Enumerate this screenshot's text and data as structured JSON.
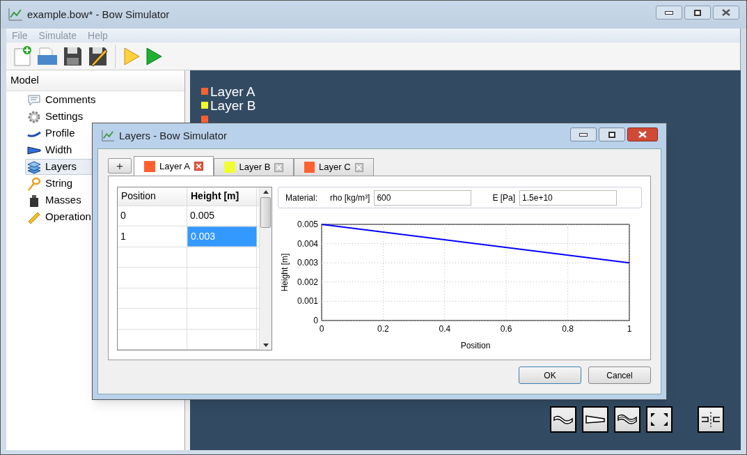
{
  "window": {
    "title": "example.bow* - Bow Simulator"
  },
  "menu": [
    "File",
    "Simulate",
    "Help"
  ],
  "sidebar": {
    "header": "Model",
    "items": [
      {
        "label": "Comments",
        "selected": false
      },
      {
        "label": "Settings",
        "selected": false
      },
      {
        "label": "Profile",
        "selected": false
      },
      {
        "label": "Width",
        "selected": false
      },
      {
        "label": "Layers",
        "selected": true
      },
      {
        "label": "String",
        "selected": false
      },
      {
        "label": "Masses",
        "selected": false
      },
      {
        "label": "Operation",
        "selected": false
      }
    ]
  },
  "legend": [
    {
      "label": "Layer A",
      "color": "#ff6030"
    },
    {
      "label": "Layer B",
      "color": "#f0ff30"
    },
    {
      "color": "#ff6030"
    }
  ],
  "dialog": {
    "title": "Layers - Bow Simulator",
    "add_button": "+",
    "tabs": [
      {
        "label": "Layer A",
        "color": "#ff6030",
        "selected": true
      },
      {
        "label": "Layer B",
        "color": "#f0ff30",
        "selected": false
      },
      {
        "label": "Layer C",
        "color": "#ff6030",
        "selected": false
      }
    ],
    "table": {
      "columns": [
        "Position",
        "Height [m]"
      ],
      "rows": [
        {
          "cells": [
            "0",
            "0.005"
          ],
          "selected": false
        },
        {
          "cells": [
            "1",
            "0.003"
          ],
          "selected": true
        }
      ]
    },
    "material": {
      "label": "Material:",
      "rho_label": "rho [kg/m³]",
      "rho_value": "600",
      "e_label": "E [Pa]",
      "e_value": "1.5e+10"
    },
    "chart_data": {
      "type": "line",
      "xlabel": "Position",
      "ylabel": "Height [m]",
      "x": [
        0,
        1
      ],
      "series": [
        {
          "color": "#0000ff",
          "values": [
            0.005,
            0.003
          ]
        }
      ],
      "grid": true,
      "xlim": [
        0,
        1
      ],
      "ylim": [
        0,
        0.005
      ],
      "xticks": [
        0,
        0.2,
        0.4,
        0.6,
        0.8,
        1
      ],
      "yticks": [
        0,
        0.001,
        0.002,
        0.003,
        0.004,
        0.005
      ]
    },
    "buttons": [
      "OK",
      "Cancel"
    ]
  }
}
